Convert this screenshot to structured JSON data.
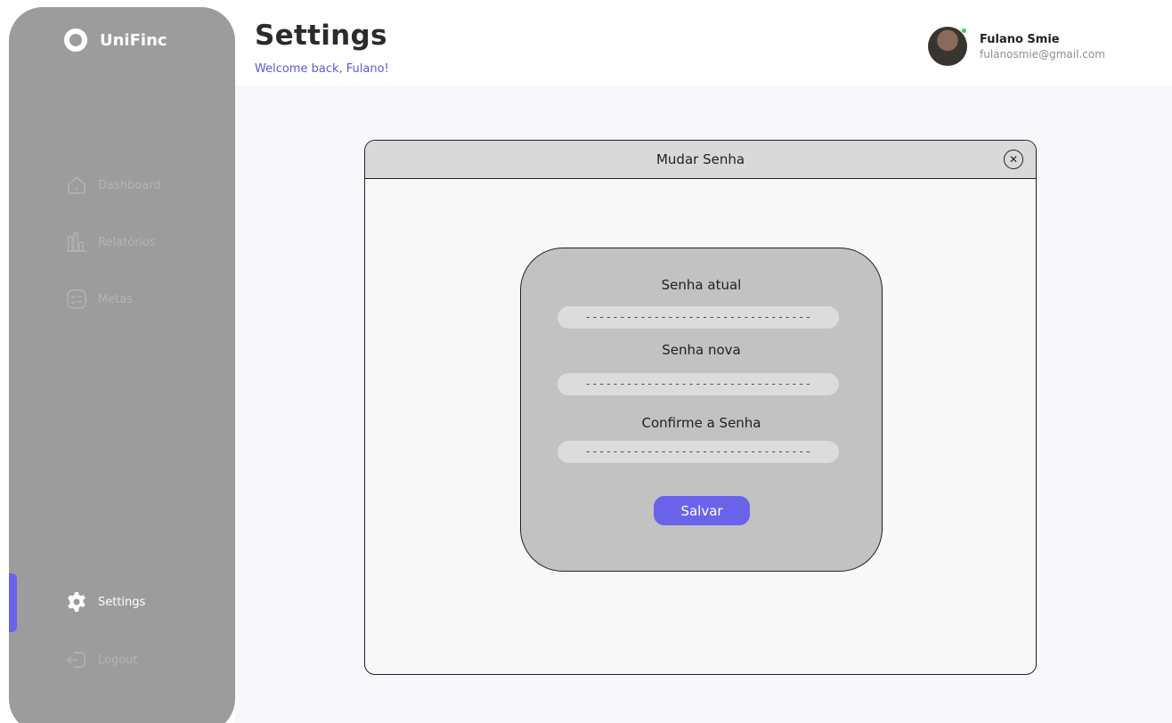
{
  "app": {
    "name": "UniFinc"
  },
  "sidebar": {
    "items": [
      {
        "label": "Dashboard",
        "icon": "home-icon"
      },
      {
        "label": "Relatórios",
        "icon": "bar-chart-icon"
      },
      {
        "label": "Metas",
        "icon": "checklist-icon"
      },
      {
        "label": "Settings",
        "icon": "gear-icon",
        "active": true
      },
      {
        "label": "Logout",
        "icon": "logout-icon"
      }
    ]
  },
  "header": {
    "title": "Settings",
    "welcome": "Welcome back, Fulano!"
  },
  "user": {
    "name": "Fulano Smie",
    "email": "fulanosmie@gmail.com",
    "status": "online"
  },
  "modal": {
    "title": "Mudar Senha",
    "fields": [
      {
        "label": "Senha atual",
        "value": "---------------------------------"
      },
      {
        "label": "Senha nova",
        "value": "---------------------------------"
      },
      {
        "label": "Confirme a Senha",
        "value": "---------------------------------"
      }
    ],
    "save_label": "Salvar"
  },
  "colors": {
    "accent": "#6a63ea",
    "sidebar_bg": "#9c9c9c",
    "online": "#39d353"
  }
}
